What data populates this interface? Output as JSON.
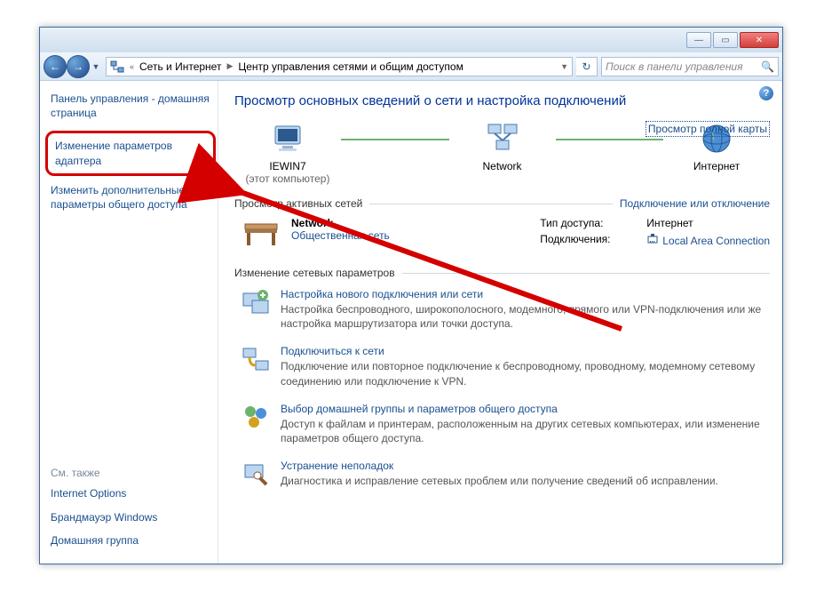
{
  "titlebar": {
    "minimize": "—",
    "maximize": "▭",
    "close": "✕"
  },
  "nav": {
    "back": "←",
    "forward": "→",
    "chevrons": "«",
    "crumb1": "Сеть и Интернет",
    "crumb2": "Центр управления сетями и общим доступом",
    "refresh": "↻",
    "search_placeholder": "Поиск в панели управления"
  },
  "sidebar": {
    "cp_home": "Панель управления - домашняя страница",
    "adapter_settings": "Изменение параметров адаптера",
    "adv_sharing": "Изменить дополнительные параметры общего доступа",
    "see_also": "См. также",
    "inet_options": "Internet Options",
    "firewall": "Брандмауэр Windows",
    "homegroup": "Домашняя группа"
  },
  "main": {
    "heading": "Просмотр основных сведений о сети и настройка подключений",
    "full_map": "Просмотр полной карты",
    "nodes": {
      "pc_name": "IEWIN7",
      "pc_sub": "(этот компьютер)",
      "network": "Network",
      "internet": "Интернет"
    },
    "active_nets_header": "Просмотр активных сетей",
    "connect_disconnect": "Подключение или отключение",
    "network": {
      "name": "Network",
      "type": "Общественная сеть",
      "access_label": "Тип доступа:",
      "access_value": "Интернет",
      "conn_label": "Подключения:",
      "conn_value": "Local Area Connection"
    },
    "change_header": "Изменение сетевых параметров",
    "tasks": [
      {
        "title": "Настройка нового подключения или сети",
        "desc": "Настройка беспроводного, широкополосного, модемного, прямого или VPN-подключения или же настройка маршрутизатора или точки доступа."
      },
      {
        "title": "Подключиться к сети",
        "desc": "Подключение или повторное подключение к беспроводному, проводному, модемному сетевому соединению или подключение к VPN."
      },
      {
        "title": "Выбор домашней группы и параметров общего доступа",
        "desc": "Доступ к файлам и принтерам, расположенным на других сетевых компьютерах, или изменение параметров общего доступа."
      },
      {
        "title": "Устранение неполадок",
        "desc": "Диагностика и исправление сетевых проблем или получение сведений об исправлении."
      }
    ]
  }
}
